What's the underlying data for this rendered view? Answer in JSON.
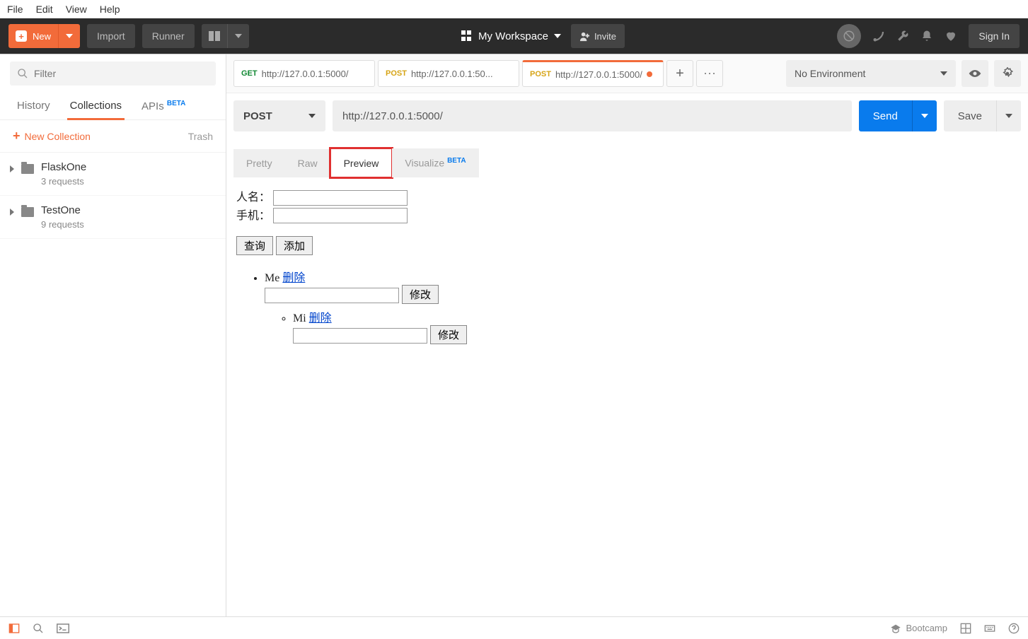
{
  "menu": {
    "file": "File",
    "edit": "Edit",
    "view": "View",
    "help": "Help"
  },
  "toolbar": {
    "new": "New",
    "import": "Import",
    "runner": "Runner",
    "workspace": "My Workspace",
    "invite": "Invite",
    "signin": "Sign In"
  },
  "sidebar": {
    "filter_placeholder": "Filter",
    "tabs": {
      "history": "History",
      "collections": "Collections",
      "apis": "APIs"
    },
    "beta": "BETA",
    "new_collection": "New Collection",
    "trash": "Trash",
    "collections": [
      {
        "name": "FlaskOne",
        "sub": "3 requests"
      },
      {
        "name": "TestOne",
        "sub": "9 requests"
      }
    ]
  },
  "tabs": [
    {
      "method": "GET",
      "label": "http://127.0.0.1:5000/"
    },
    {
      "method": "POST",
      "label": "http://127.0.0.1:50..."
    },
    {
      "method": "POST",
      "label": "http://127.0.0.1:5000/",
      "active": true,
      "dirty": true
    }
  ],
  "env": {
    "label": "No Environment"
  },
  "request": {
    "method": "POST",
    "url": "http://127.0.0.1:5000/",
    "send": "Send",
    "save": "Save"
  },
  "response": {
    "tabs": {
      "pretty": "Pretty",
      "raw": "Raw",
      "preview": "Preview",
      "visualize": "Visualize"
    },
    "beta": "BETA"
  },
  "preview": {
    "label_name": "人名：",
    "label_phone": "手机：",
    "btn_query": "查询",
    "btn_add": "添加",
    "items": [
      {
        "name": "Me",
        "delete": "删除",
        "modify": "修改",
        "children": [
          {
            "name": "Mi",
            "delete": "删除",
            "modify": "修改"
          }
        ]
      }
    ]
  },
  "status": {
    "bootcamp": "Bootcamp"
  }
}
